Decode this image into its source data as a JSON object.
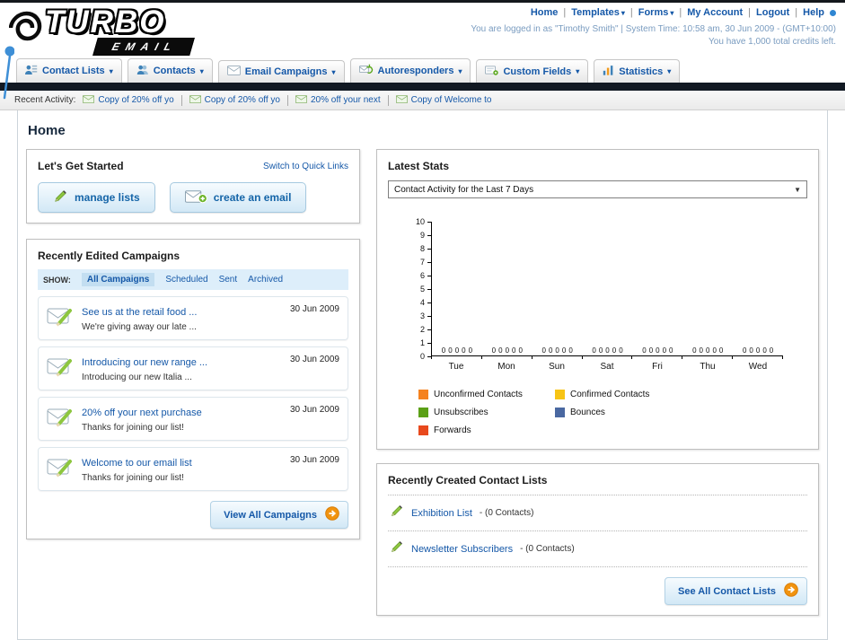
{
  "header": {
    "logo": {
      "line1": "TURBO",
      "line2": "EMAIL"
    },
    "top_links": [
      {
        "label": "Home",
        "dropdown": false
      },
      {
        "label": "Templates",
        "dropdown": true
      },
      {
        "label": "Forms",
        "dropdown": true
      },
      {
        "label": "My Account",
        "dropdown": false
      },
      {
        "label": "Logout",
        "dropdown": false
      },
      {
        "label": "Help",
        "dropdown": false
      }
    ],
    "login_info": "You are logged in as \"Timothy Smith\" | System Time: 10:58 am, 30 Jun 2009 - (GMT+10:00)",
    "credits": "You have 1,000 total credits left."
  },
  "nav": {
    "tabs": [
      {
        "label": "Contact Lists",
        "icon": "contact-lists"
      },
      {
        "label": "Contacts",
        "icon": "contacts"
      },
      {
        "label": "Email Campaigns",
        "icon": "email-campaigns"
      },
      {
        "label": "Autoresponders",
        "icon": "autoresponders"
      },
      {
        "label": "Custom Fields",
        "icon": "custom-fields"
      },
      {
        "label": "Statistics",
        "icon": "statistics"
      }
    ]
  },
  "recent_activity": {
    "label": "Recent Activity:",
    "items": [
      "Copy of 20% off yo",
      "Copy of 20% off yo",
      "20% off your next",
      "Copy of Welcome to"
    ]
  },
  "page": {
    "title": "Home"
  },
  "get_started": {
    "title": "Let's Get Started",
    "switch_link": "Switch to Quick Links",
    "manage_lists": "manage lists",
    "create_email": "create an email"
  },
  "campaigns": {
    "title": "Recently Edited Campaigns",
    "show_label": "SHOW:",
    "filters": [
      "All Campaigns",
      "Scheduled",
      "Sent",
      "Archived"
    ],
    "active_filter": "All Campaigns",
    "items": [
      {
        "title": "See us at the retail food ...",
        "subtitle": "We're giving away our late ...",
        "date": "30 Jun 2009"
      },
      {
        "title": "Introducing our new range ...",
        "subtitle": "Introducing our new Italia ...",
        "date": "30 Jun 2009"
      },
      {
        "title": "20% off your next purchase",
        "subtitle": "Thanks for joining our list!",
        "date": "30 Jun 2009"
      },
      {
        "title": "Welcome to our email list",
        "subtitle": "Thanks for joining our list!",
        "date": "30 Jun 2009"
      }
    ],
    "view_all": "View All Campaigns"
  },
  "stats": {
    "title": "Latest Stats",
    "dropdown_value": "Contact Activity for the Last 7 Days"
  },
  "chart_data": {
    "type": "bar",
    "title": "Contact Activity for the Last 7 Days",
    "categories": [
      "Tue",
      "Mon",
      "Sun",
      "Sat",
      "Fri",
      "Thu",
      "Wed"
    ],
    "series": [
      {
        "name": "Unconfirmed Contacts",
        "color": "#f5821f",
        "values": [
          0,
          0,
          0,
          0,
          0,
          0,
          0
        ]
      },
      {
        "name": "Confirmed Contacts",
        "color": "#f7c415",
        "values": [
          0,
          0,
          0,
          0,
          0,
          0,
          0
        ]
      },
      {
        "name": "Unsubscribes",
        "color": "#5ba016",
        "values": [
          0,
          0,
          0,
          0,
          0,
          0,
          0
        ]
      },
      {
        "name": "Bounces",
        "color": "#4a68a1",
        "values": [
          0,
          0,
          0,
          0,
          0,
          0,
          0
        ]
      },
      {
        "name": "Forwards",
        "color": "#e8491d",
        "values": [
          0,
          0,
          0,
          0,
          0,
          0,
          0
        ]
      }
    ],
    "ylim": [
      0,
      10
    ],
    "ytick_step": 1,
    "show_value_labels": true,
    "grid": false,
    "legend_position": "bottom"
  },
  "contact_lists": {
    "title": "Recently Created Contact Lists",
    "items": [
      {
        "name": "Exhibition List",
        "detail": "- (0 Contacts)"
      },
      {
        "name": "Newsletter Subscribers",
        "detail": "- (0 Contacts)"
      }
    ],
    "see_all": "See All Contact Lists"
  }
}
